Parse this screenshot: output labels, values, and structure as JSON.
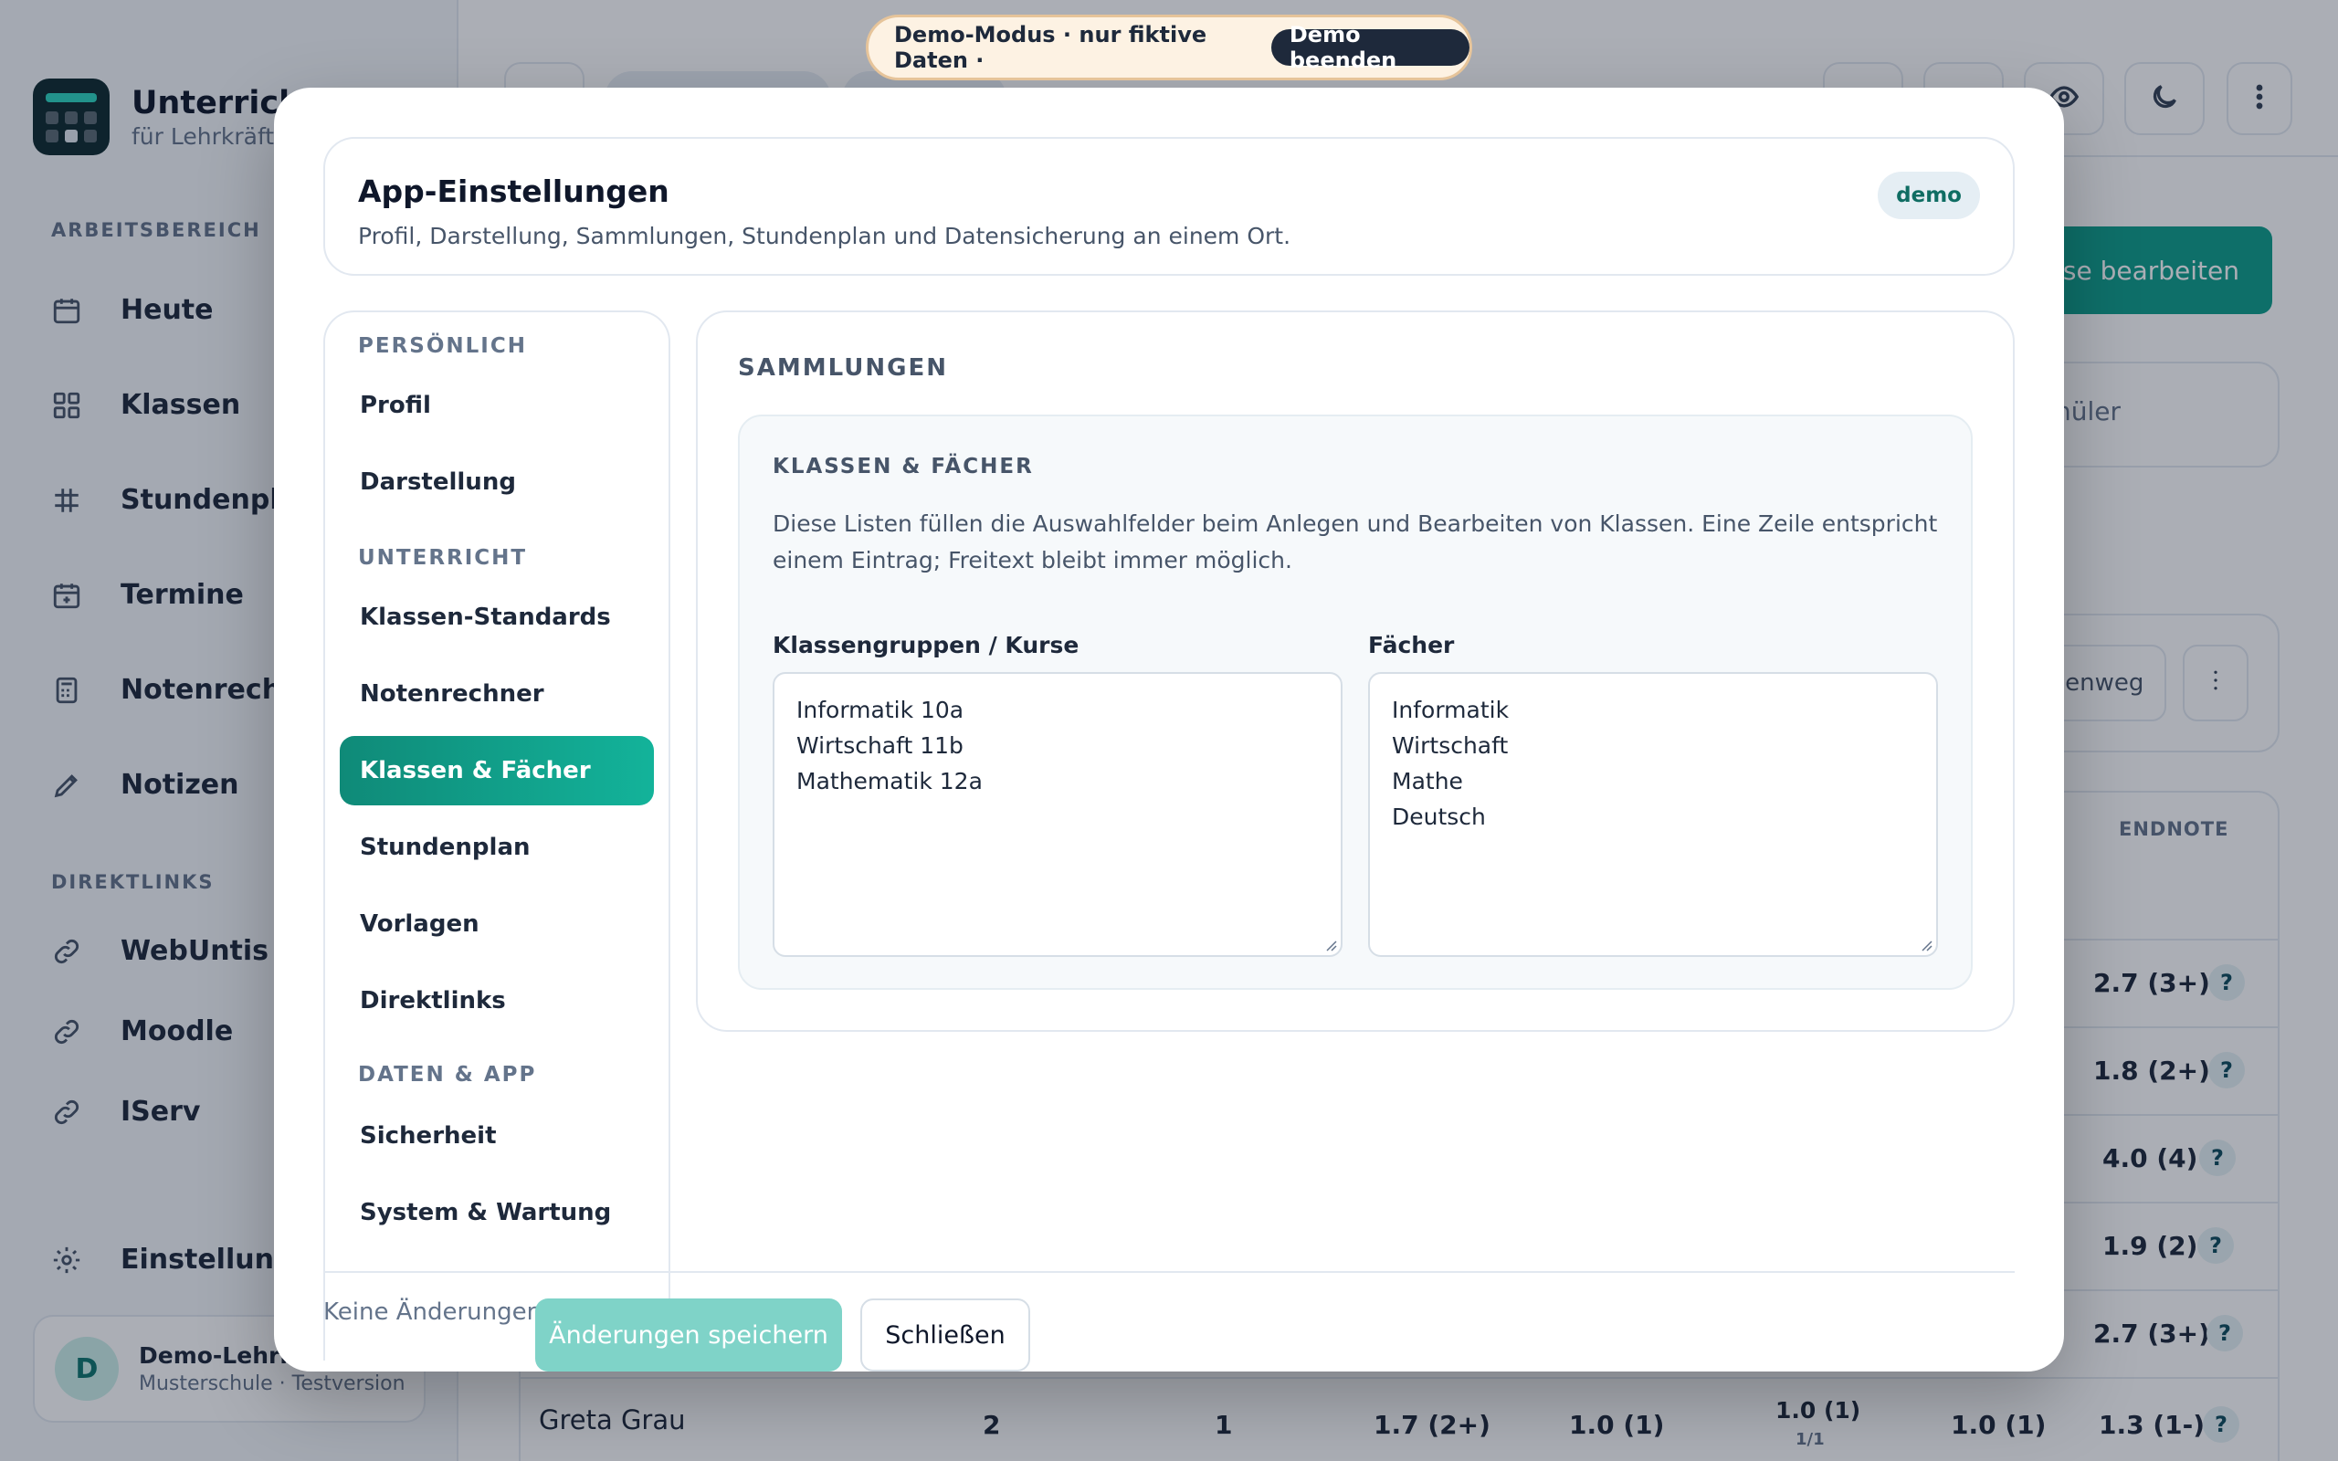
{
  "app": {
    "title": "UnterrichtP",
    "subtitle": "für Lehrkräfte"
  },
  "sidebar": {
    "section_work": "ARBEITSBEREICH",
    "items": [
      {
        "label": "Heute",
        "icon": "calendar-icon"
      },
      {
        "label": "Klassen",
        "icon": "grid-icon"
      },
      {
        "label": "Stundenplan",
        "icon": "timetable-icon"
      },
      {
        "label": "Termine",
        "icon": "calendar-plus-icon"
      },
      {
        "label": "Notenrechn",
        "icon": "calculator-icon"
      },
      {
        "label": "Notizen",
        "icon": "pencil-icon"
      }
    ],
    "section_links": "DIREKTLINKS",
    "links": [
      {
        "label": "WebUntis",
        "icon": "link-icon"
      },
      {
        "label": "Moodle",
        "icon": "link-icon"
      },
      {
        "label": "IServ",
        "icon": "link-icon"
      }
    ],
    "settings_label": "Einstellunge",
    "user": {
      "initial": "D",
      "name": "Demo-Lehrkr",
      "school": "Musterschule · Testversion"
    }
  },
  "demo_banner": {
    "text": "Demo-Modus · nur fiktive Daten ·",
    "end_label": "Demo beenden"
  },
  "background": {
    "edit_button": "asse bearbeiten",
    "search_text": "nüler",
    "mini_button": "henweg",
    "table_header": "ENDNOTE",
    "rows": [
      {
        "grade": "2.7 (3+)"
      },
      {
        "grade": "1.8 (2+)"
      },
      {
        "grade": "4.0 (4)"
      },
      {
        "grade": "1.9 (2)"
      },
      {
        "grade": "2.7 (3+)"
      }
    ],
    "last_row": {
      "name": "Greta Grau",
      "c1": "2",
      "c2": "1",
      "c3": "1.7 (2+)",
      "c4": "1.0 (1)",
      "c5": "1.0 (1)",
      "c5_sub": "1/1",
      "c6": "1.0 (1)",
      "c7": "1.3 (1-)"
    },
    "help_symbol": "?"
  },
  "modal": {
    "title": "App-Einstellungen",
    "subtitle": "Profil, Darstellung, Sammlungen, Stundenplan und Datensicherung an einem Ort.",
    "badge": "demo",
    "nav": {
      "section_personal": "PERSÖNLICH",
      "section_teaching": "UNTERRICHT",
      "section_data": "DATEN & APP",
      "items": [
        "Profil",
        "Darstellung",
        "Klassen-Standards",
        "Notenrechner",
        "Klassen & Fächer",
        "Stundenplan",
        "Vorlagen",
        "Direktlinks",
        "Sicherheit",
        "System & Wartung"
      ],
      "active_index": 4
    },
    "panel": {
      "title": "SAMMLUNGEN",
      "group_title": "KLASSEN & FÄCHER",
      "description": "Diese Listen füllen die Auswahlfelder beim Anlegen und Bearbeiten von Klassen. Eine Zeile entspricht einem Eintrag; Freitext bleibt immer möglich.",
      "groups_label": "Klassengruppen / Kurse",
      "groups": [
        "Informatik 10a",
        "Wirtschaft 11b",
        "Mathematik 12a"
      ],
      "subjects_label": "Fächer",
      "subjects": [
        "Informatik",
        "Wirtschaft",
        "Mathe",
        "Deutsch"
      ]
    },
    "footer": {
      "status": "Keine Änderungen",
      "save_label": "Änderungen speichern",
      "close_label": "Schließen"
    }
  },
  "colors": {
    "accent": "#0f9f8a",
    "accent_light": "#7fd3c8",
    "banner_bg": "#fdf2e3",
    "banner_border": "#e6c49a"
  }
}
